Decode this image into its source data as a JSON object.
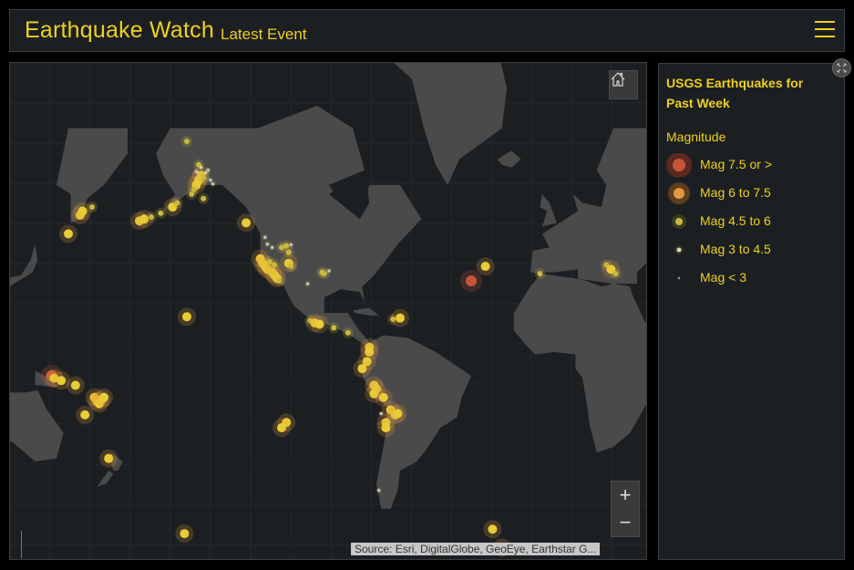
{
  "header": {
    "title": "Earthquake Watch",
    "subtitle": "Latest Event",
    "menu_icon": "hamburger-menu-icon"
  },
  "map": {
    "home_icon": "home-icon",
    "zoom_in_label": "+",
    "zoom_out_label": "−",
    "attribution": "Source: Esri, DigitalGlobe, GeoEye, Earthstar G...",
    "basemap_colors": {
      "ocean": "#1b1f22",
      "land": "#4a4a4a",
      "grid": "#24292c"
    },
    "quakes": [
      {
        "lon": -150,
        "lat": 64,
        "cls": 3
      },
      {
        "lon": -149,
        "lat": 62,
        "cls": 2
      },
      {
        "lon": -150,
        "lat": 61,
        "cls": 2
      },
      {
        "lon": -151,
        "lat": 60,
        "cls": 2
      },
      {
        "lon": -148,
        "lat": 61.5,
        "cls": 3
      },
      {
        "lon": -152,
        "lat": 59,
        "cls": 3
      },
      {
        "lon": -153,
        "lat": 58,
        "cls": 3
      },
      {
        "lon": -147,
        "lat": 62.5,
        "cls": 4
      },
      {
        "lon": -146,
        "lat": 63,
        "cls": 4
      },
      {
        "lon": -149,
        "lat": 63.5,
        "cls": 4
      },
      {
        "lon": -151,
        "lat": 62.7,
        "cls": 4
      },
      {
        "lon": -145,
        "lat": 61,
        "cls": 4
      },
      {
        "lon": -144,
        "lat": 60.2,
        "cls": 4
      },
      {
        "lon": -155,
        "lat": 68,
        "cls": 3
      },
      {
        "lon": -148,
        "lat": 57,
        "cls": 3
      },
      {
        "lon": -175,
        "lat": 51.5,
        "cls": 2
      },
      {
        "lon": -173,
        "lat": 52,
        "cls": 2
      },
      {
        "lon": -170,
        "lat": 52.5,
        "cls": 3
      },
      {
        "lon": -166,
        "lat": 53.5,
        "cls": 3
      },
      {
        "lon": -161,
        "lat": 55,
        "cls": 2
      },
      {
        "lon": -159,
        "lat": 56,
        "cls": 3
      },
      {
        "lon": 160,
        "lat": 53,
        "cls": 2
      },
      {
        "lon": 161,
        "lat": 54,
        "cls": 2
      },
      {
        "lon": 165,
        "lat": 55,
        "cls": 3
      },
      {
        "lon": 155,
        "lat": 48,
        "cls": 2
      },
      {
        "lon": -130,
        "lat": 51,
        "cls": 2
      },
      {
        "lon": -122,
        "lat": 47,
        "cls": 4
      },
      {
        "lon": -121,
        "lat": 45,
        "cls": 4
      },
      {
        "lon": -119,
        "lat": 44,
        "cls": 4
      },
      {
        "lon": -124,
        "lat": 40.5,
        "cls": 2
      },
      {
        "lon": -123,
        "lat": 39,
        "cls": 2
      },
      {
        "lon": -122,
        "lat": 38,
        "cls": 2
      },
      {
        "lon": -121,
        "lat": 37,
        "cls": 2
      },
      {
        "lon": -119,
        "lat": 36,
        "cls": 2
      },
      {
        "lon": -118,
        "lat": 35,
        "cls": 2
      },
      {
        "lon": -117,
        "lat": 34,
        "cls": 2
      },
      {
        "lon": -116,
        "lat": 33,
        "cls": 3
      },
      {
        "lon": -120,
        "lat": 39.5,
        "cls": 3
      },
      {
        "lon": -118,
        "lat": 38.5,
        "cls": 3
      },
      {
        "lon": -115,
        "lat": 44,
        "cls": 3
      },
      {
        "lon": -113,
        "lat": 44.5,
        "cls": 3
      },
      {
        "lon": -112,
        "lat": 42.5,
        "cls": 3
      },
      {
        "lon": -111,
        "lat": 44.8,
        "cls": 4
      },
      {
        "lon": -112,
        "lat": 39,
        "cls": 2
      },
      {
        "lon": -111,
        "lat": 38,
        "cls": 3
      },
      {
        "lon": -98,
        "lat": 36,
        "cls": 3
      },
      {
        "lon": -97,
        "lat": 35.5,
        "cls": 3
      },
      {
        "lon": -95,
        "lat": 36.5,
        "cls": 4
      },
      {
        "lon": -104,
        "lat": 32,
        "cls": 4
      },
      {
        "lon": -155,
        "lat": 19.5,
        "cls": 2
      },
      {
        "lon": -103,
        "lat": 18,
        "cls": 3
      },
      {
        "lon": -101,
        "lat": 17,
        "cls": 2
      },
      {
        "lon": -99,
        "lat": 16.5,
        "cls": 2
      },
      {
        "lon": -93,
        "lat": 15,
        "cls": 3
      },
      {
        "lon": -87,
        "lat": 13,
        "cls": 3
      },
      {
        "lon": -68,
        "lat": 18.5,
        "cls": 3
      },
      {
        "lon": -65,
        "lat": 19,
        "cls": 2
      },
      {
        "lon": -29,
        "lat": 38,
        "cls": 2
      },
      {
        "lon": -35,
        "lat": 33,
        "cls": 1
      },
      {
        "lon": -6,
        "lat": 35.5,
        "cls": 3
      },
      {
        "lon": 22,
        "lat": 38.5,
        "cls": 3
      },
      {
        "lon": 24,
        "lat": 37,
        "cls": 2
      },
      {
        "lon": 26,
        "lat": 35.5,
        "cls": 3
      },
      {
        "lon": -78,
        "lat": 7,
        "cls": 2
      },
      {
        "lon": -78,
        "lat": 5,
        "cls": 2
      },
      {
        "lon": -79,
        "lat": 1,
        "cls": 2
      },
      {
        "lon": -81,
        "lat": -2,
        "cls": 2
      },
      {
        "lon": -76,
        "lat": -9,
        "cls": 2
      },
      {
        "lon": -75,
        "lat": -10.5,
        "cls": 2
      },
      {
        "lon": -76,
        "lat": -12.5,
        "cls": 2
      },
      {
        "lon": -72,
        "lat": -14,
        "cls": 2
      },
      {
        "lon": -69,
        "lat": -19,
        "cls": 2
      },
      {
        "lon": -67,
        "lat": -21,
        "cls": 2
      },
      {
        "lon": -66,
        "lat": -20.5,
        "cls": 2
      },
      {
        "lon": -71,
        "lat": -24,
        "cls": 2
      },
      {
        "lon": -71,
        "lat": -26,
        "cls": 2
      },
      {
        "lon": -73,
        "lat": -20.5,
        "cls": 4
      },
      {
        "lon": -74,
        "lat": -47,
        "cls": 4
      },
      {
        "lon": -26,
        "lat": -57,
        "cls": 2
      },
      {
        "lon": -22,
        "lat": -61,
        "cls": 2
      },
      {
        "lon": -113,
        "lat": -24,
        "cls": 2
      },
      {
        "lon": -115,
        "lat": -26,
        "cls": 2
      },
      {
        "lon": 148,
        "lat": -5,
        "cls": 1
      },
      {
        "lon": 149,
        "lat": -6,
        "cls": 2
      },
      {
        "lon": 152,
        "lat": -7,
        "cls": 2
      },
      {
        "lon": 158,
        "lat": -9,
        "cls": 2
      },
      {
        "lon": 166,
        "lat": -14,
        "cls": 2
      },
      {
        "lon": 167,
        "lat": -15.5,
        "cls": 2
      },
      {
        "lon": 169,
        "lat": -15,
        "cls": 2
      },
      {
        "lon": 168,
        "lat": -16.5,
        "cls": 2
      },
      {
        "lon": 170,
        "lat": -14,
        "cls": 2
      },
      {
        "lon": 162,
        "lat": -21,
        "cls": 2
      },
      {
        "lon": 172,
        "lat": -37,
        "cls": 2
      },
      {
        "lon": -156,
        "lat": -58,
        "cls": 2
      }
    ]
  },
  "legend": {
    "title": "USGS Earthquakes for Past Week",
    "field_label": "Magnitude",
    "expand_icon": "expand-icon",
    "items": [
      {
        "label": "Mag 7.5 or >",
        "color": "#c8553a",
        "halo": "#5a2a22",
        "size": 5
      },
      {
        "label": "Mag 6 to 7.5",
        "color": "#e39a3e",
        "halo": "#5e3d20",
        "size": 4
      },
      {
        "label": "Mag 4.5 to 6",
        "color": "#c9b83e",
        "halo": "#3a3a20",
        "size": 3
      },
      {
        "label": "Mag 3 to 4.5",
        "color": "#d6d6b0",
        "halo": "#2f3128",
        "size": 2
      },
      {
        "label": "Mag < 3",
        "color": "#a0a090",
        "halo": "#222",
        "size": 1
      }
    ]
  }
}
